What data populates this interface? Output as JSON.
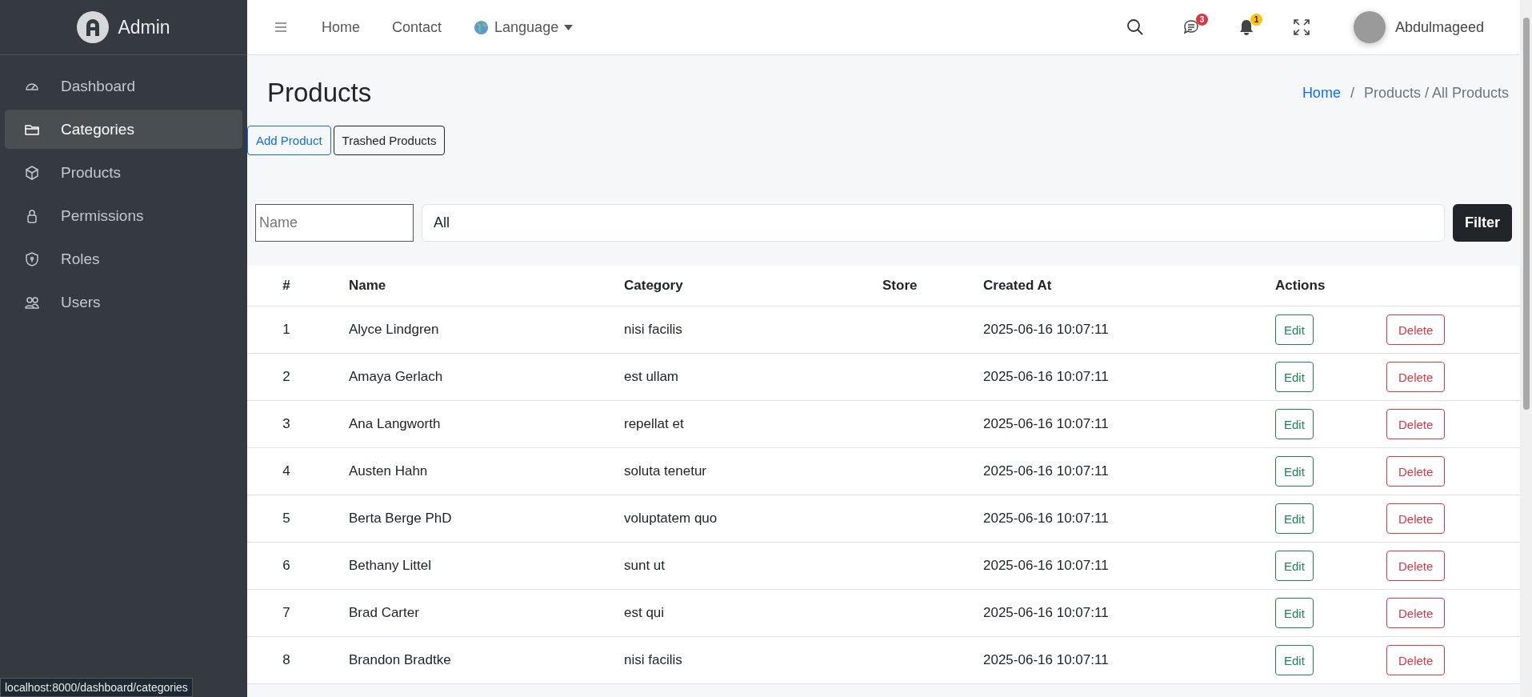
{
  "sidebar": {
    "brand": "Admin",
    "items": [
      {
        "label": "Dashboard",
        "kind": "gauge",
        "selected": false
      },
      {
        "label": "Categories",
        "kind": "folder",
        "selected": true
      },
      {
        "label": "Products",
        "kind": "box",
        "selected": false
      },
      {
        "label": "Permissions",
        "kind": "lock",
        "selected": false
      },
      {
        "label": "Roles",
        "kind": "shield",
        "selected": false
      },
      {
        "label": "Users",
        "kind": "users",
        "selected": false
      }
    ]
  },
  "topbar": {
    "nav": [
      "Home",
      "Contact"
    ],
    "language": "Language",
    "messages_badge": {
      "count": "3",
      "color": "#dc3545"
    },
    "notifications_badge": {
      "count": "1",
      "color": "#ffc107"
    },
    "user": "Abdulmageed"
  },
  "page": {
    "title": "Products",
    "breadcrumb": {
      "link": "Home",
      "separator": "/",
      "current": "Products / All Products"
    },
    "buttons": [
      {
        "label": "Add Product",
        "kind": "primary"
      },
      {
        "label": "Trashed Products",
        "kind": "dark"
      }
    ],
    "filter": {
      "name_placeholder": "Name",
      "select_value": "All",
      "button": "Filter"
    }
  },
  "table": {
    "columns": [
      "#",
      "Name",
      "Category",
      "Store",
      "Created At",
      "Actions"
    ],
    "rows": [
      {
        "number": "1",
        "name": "Alyce Lindgren",
        "category": "nisi facilis",
        "created_at": "2025-06-16 10:07:11",
        "actions": [
          {
            "label": "Edit",
            "kind": "edit"
          },
          {
            "label": "Delete",
            "kind": "delete"
          }
        ]
      },
      {
        "number": "2",
        "name": "Amaya Gerlach",
        "category": "est ullam",
        "created_at": "2025-06-16 10:07:11",
        "actions": [
          {
            "label": "Edit",
            "kind": "edit"
          },
          {
            "label": "Delete",
            "kind": "delete"
          }
        ]
      },
      {
        "number": "3",
        "name": "Ana Langworth",
        "category": "repellat et",
        "created_at": "2025-06-16 10:07:11",
        "actions": [
          {
            "label": "Edit",
            "kind": "edit"
          },
          {
            "label": "Delete",
            "kind": "delete"
          }
        ]
      },
      {
        "number": "4",
        "name": "Austen Hahn",
        "category": "soluta tenetur",
        "created_at": "2025-06-16 10:07:11",
        "actions": [
          {
            "label": "Edit",
            "kind": "edit"
          },
          {
            "label": "Delete",
            "kind": "delete"
          }
        ]
      },
      {
        "number": "5",
        "name": "Berta Berge PhD",
        "category": "voluptatem quo",
        "created_at": "2025-06-16 10:07:11",
        "actions": [
          {
            "label": "Edit",
            "kind": "edit"
          },
          {
            "label": "Delete",
            "kind": "delete"
          }
        ]
      },
      {
        "number": "6",
        "name": "Bethany Littel",
        "category": "sunt ut",
        "created_at": "2025-06-16 10:07:11",
        "actions": [
          {
            "label": "Edit",
            "kind": "edit"
          },
          {
            "label": "Delete",
            "kind": "delete"
          }
        ]
      },
      {
        "number": "7",
        "name": "Brad Carter",
        "category": "est qui",
        "created_at": "2025-06-16 10:07:11",
        "actions": [
          {
            "label": "Edit",
            "kind": "edit"
          },
          {
            "label": "Delete",
            "kind": "delete"
          }
        ]
      },
      {
        "number": "8",
        "name": "Brandon Bradtke",
        "category": "nisi facilis",
        "created_at": "2025-06-16 10:07:11",
        "actions": [
          {
            "label": "Edit",
            "kind": "edit"
          },
          {
            "label": "Delete",
            "kind": "delete"
          }
        ]
      }
    ]
  },
  "status_bar": "localhost:8000/dashboard/categories"
}
